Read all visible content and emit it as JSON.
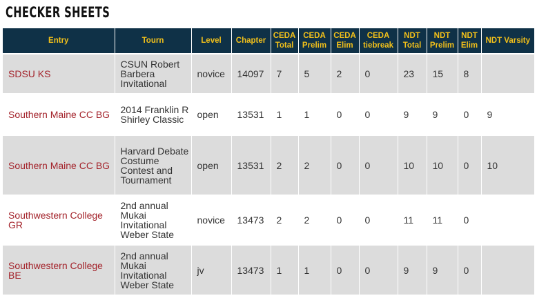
{
  "title": "CHECKER SHEETS",
  "columns": [
    {
      "label": "Entry"
    },
    {
      "label": "Tourn"
    },
    {
      "label": "Level"
    },
    {
      "label": "Chapter"
    },
    {
      "label": "CEDA Total"
    },
    {
      "label": "CEDA Prelim"
    },
    {
      "label": "CEDA Elim"
    },
    {
      "label": "CEDA tiebreak"
    },
    {
      "label": "NDT Total"
    },
    {
      "label": "NDT Prelim"
    },
    {
      "label": "NDT Elim"
    },
    {
      "label": "NDT Varsity"
    }
  ],
  "rows": [
    {
      "entry": "SDSU KS",
      "tourn": "CSUN Robert Barbera Invitational",
      "level": "novice",
      "chapter": "14097",
      "ceda_total": "7",
      "ceda_prelim": "5",
      "ceda_elim": "2",
      "ceda_tiebreak": "0",
      "ndt_total": "23",
      "ndt_prelim": "15",
      "ndt_elim": "8",
      "ndt_varsity": ""
    },
    {
      "entry": "Southern Maine CC BG",
      "tourn": "2014 Franklin R Shirley Classic",
      "level": "open",
      "chapter": "13531",
      "ceda_total": "1",
      "ceda_prelim": "1",
      "ceda_elim": "0",
      "ceda_tiebreak": "0",
      "ndt_total": "9",
      "ndt_prelim": "9",
      "ndt_elim": "0",
      "ndt_varsity": "9"
    },
    {
      "entry": "Southern Maine CC BG",
      "tourn": "Harvard Debate Costume Contest and Tournament",
      "level": "open",
      "chapter": "13531",
      "ceda_total": "2",
      "ceda_prelim": "2",
      "ceda_elim": "0",
      "ceda_tiebreak": "0",
      "ndt_total": "10",
      "ndt_prelim": "10",
      "ndt_elim": "0",
      "ndt_varsity": "10"
    },
    {
      "entry": "Southwestern College GR",
      "tourn": "2nd annual Mukai Invitational Weber State",
      "level": "novice",
      "chapter": "13473",
      "ceda_total": "2",
      "ceda_prelim": "2",
      "ceda_elim": "0",
      "ceda_tiebreak": "0",
      "ndt_total": "11",
      "ndt_prelim": "11",
      "ndt_elim": "0",
      "ndt_varsity": ""
    },
    {
      "entry": "Southwestern College BE",
      "tourn": "2nd annual Mukai Invitational Weber State",
      "level": "jv",
      "chapter": "13473",
      "ceda_total": "1",
      "ceda_prelim": "1",
      "ceda_elim": "0",
      "ceda_tiebreak": "0",
      "ndt_total": "9",
      "ndt_prelim": "9",
      "ndt_elim": "0",
      "ndt_varsity": ""
    }
  ]
}
